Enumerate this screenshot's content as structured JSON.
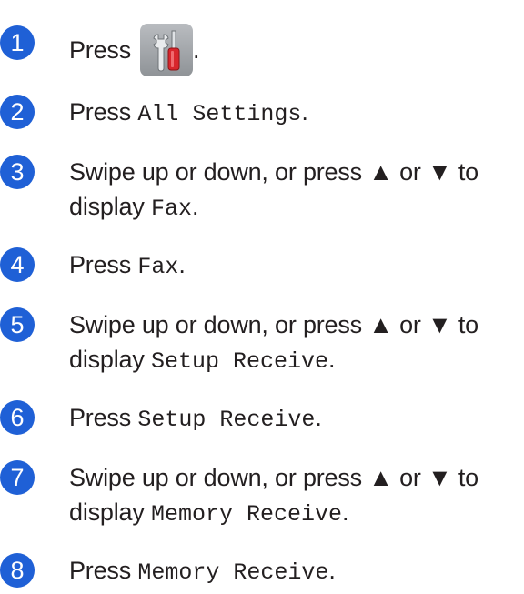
{
  "steps": [
    {
      "number": "1",
      "before": "Press",
      "icon": "settings-tools-icon",
      "after": "."
    },
    {
      "number": "2",
      "before": "Press",
      "code": "All Settings",
      "after": "."
    },
    {
      "number": "3",
      "line1": "Swipe up or down, or press ▲ or ▼ to",
      "line2_before": "display",
      "code": "Fax",
      "after": "."
    },
    {
      "number": "4",
      "before": "Press",
      "code": "Fax",
      "after": "."
    },
    {
      "number": "5",
      "line1": "Swipe up or down, or press ▲ or ▼ to",
      "line2_before": "display",
      "code": "Setup Receive",
      "after": "."
    },
    {
      "number": "6",
      "before": "Press",
      "code": "Setup Receive",
      "after": "."
    },
    {
      "number": "7",
      "line1": "Swipe up or down, or press ▲ or ▼ to",
      "line2_before": "display",
      "code": "Memory Receive",
      "after": "."
    },
    {
      "number": "8",
      "before": "Press",
      "code": "Memory Receive",
      "after": "."
    }
  ],
  "colors": {
    "step_badge": "#1f60d6",
    "text": "#231f20"
  }
}
